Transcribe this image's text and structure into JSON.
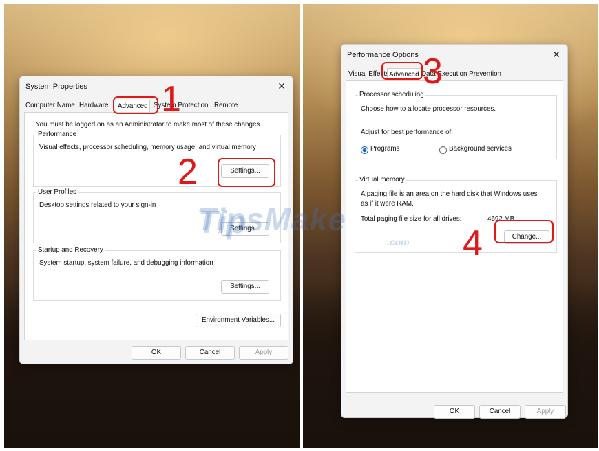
{
  "left": {
    "title": "System Properties",
    "close_glyph": "✕",
    "tabs": [
      "Computer Name",
      "Hardware",
      "Advanced",
      "System Protection",
      "Remote"
    ],
    "admin_notice": "You must be logged on as an Administrator to make most of these changes.",
    "performance": {
      "label": "Performance",
      "desc": "Visual effects, processor scheduling, memory usage, and virtual memory",
      "button": "Settings..."
    },
    "user_profiles": {
      "label": "User Profiles",
      "desc": "Desktop settings related to your sign-in",
      "button": "Settings..."
    },
    "startup": {
      "label": "Startup and Recovery",
      "desc": "System startup, system failure, and debugging information",
      "button": "Settings..."
    },
    "env_button": "Environment Variables...",
    "ok": "OK",
    "cancel": "Cancel",
    "apply": "Apply"
  },
  "right": {
    "title": "Performance Options",
    "close_glyph": "✕",
    "tabs": [
      "Visual Effects",
      "Advanced",
      "Data Execution Prevention"
    ],
    "processor": {
      "label": "Processor scheduling",
      "desc": "Choose how to allocate processor resources.",
      "adjust": "Adjust for best performance of:",
      "options": [
        "Programs",
        "Background services"
      ],
      "selected": "Programs"
    },
    "vm": {
      "label": "Virtual memory",
      "desc_line1": "A paging file is an area on the hard disk that Windows uses",
      "desc_line2": "as if it were RAM.",
      "total_label": "Total paging file size for all drives:",
      "total_value": "4692 MB",
      "button": "Change..."
    },
    "ok": "OK",
    "cancel": "Cancel",
    "apply": "Apply"
  },
  "annotations": [
    "1",
    "2",
    "3",
    "4"
  ],
  "watermark": {
    "brand": "TipsMake",
    "suffix": ".com"
  },
  "colors": {
    "annotation": "#e01818",
    "radio_selected": "#2563c9"
  }
}
